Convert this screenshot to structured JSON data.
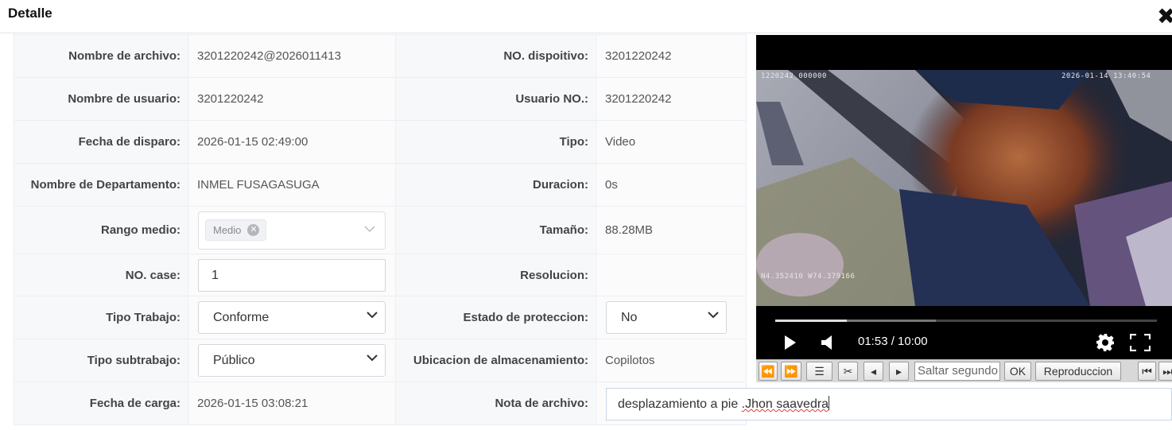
{
  "dialog": {
    "title": "Detalle",
    "close_icon": "close-icon"
  },
  "rows": {
    "nombre_archivo": {
      "label": "Nombre de archivo:",
      "value": "3201220242@2026011413"
    },
    "dispositivo": {
      "label": "NO. dispoitivo:",
      "value": "3201220242"
    },
    "nombre_usuario": {
      "label": "Nombre de usuario:",
      "value": "3201220242"
    },
    "usuario_no": {
      "label": "Usuario NO.:",
      "value": "3201220242"
    },
    "fecha_disparo": {
      "label": "Fecha de disparo:",
      "value": "2026-01-15 02:49:00"
    },
    "tipo": {
      "label": "Tipo:",
      "value": "Video"
    },
    "departamento": {
      "label": "Nombre de Departamento:",
      "value": "INMEL FUSAGASUGA"
    },
    "duracion": {
      "label": "Duracion:",
      "value": "0s"
    },
    "rango_medio": {
      "label": "Rango medio:",
      "tag": "Medio"
    },
    "tamano": {
      "label": "Tamaño:",
      "value": "88.28MB"
    },
    "no_case": {
      "label": "NO. case:",
      "value": "1"
    },
    "resolucion": {
      "label": "Resolucion:",
      "value": ""
    },
    "tipo_trabajo": {
      "label": "Tipo Trabajo:",
      "selected": "Conforme"
    },
    "estado_proteccion": {
      "label": "Estado de proteccion:",
      "selected": "No"
    },
    "tipo_subtrabajo": {
      "label": "Tipo subtrabajo:",
      "selected": "Público"
    },
    "ubicacion": {
      "label": "Ubicacion de almacenamiento:",
      "value": "Copilotos"
    },
    "fecha_carga": {
      "label": "Fecha de carga:",
      "value": "2026-01-15 03:08:21"
    },
    "nota_archivo": {
      "label": "Nota de archivo:",
      "value_plain": "desplazamiento a pie ",
      "value_marked": ".Jhon saavedra"
    }
  },
  "player": {
    "osd_device": "1220242_000000",
    "osd_datetime": "2026-01-14  13:40:54",
    "osd_gps": "N4.352410  W74.379166",
    "time_text": "01:53 / 10:00",
    "progress_fraction": 0.188,
    "icons": [
      "play-icon",
      "volume-icon",
      "settings-icon",
      "fullscreen-icon"
    ]
  },
  "toolbar": {
    "seek_placeholder": "Saltar segundo",
    "ok_label": "OK",
    "playback_label": "Reproduccion",
    "icons": [
      "rewind-icon",
      "fast-forward-icon",
      "list-icon",
      "scissors-icon",
      "frame-back-icon",
      "frame-forward-icon",
      "skip-start-icon",
      "skip-end-icon"
    ]
  }
}
